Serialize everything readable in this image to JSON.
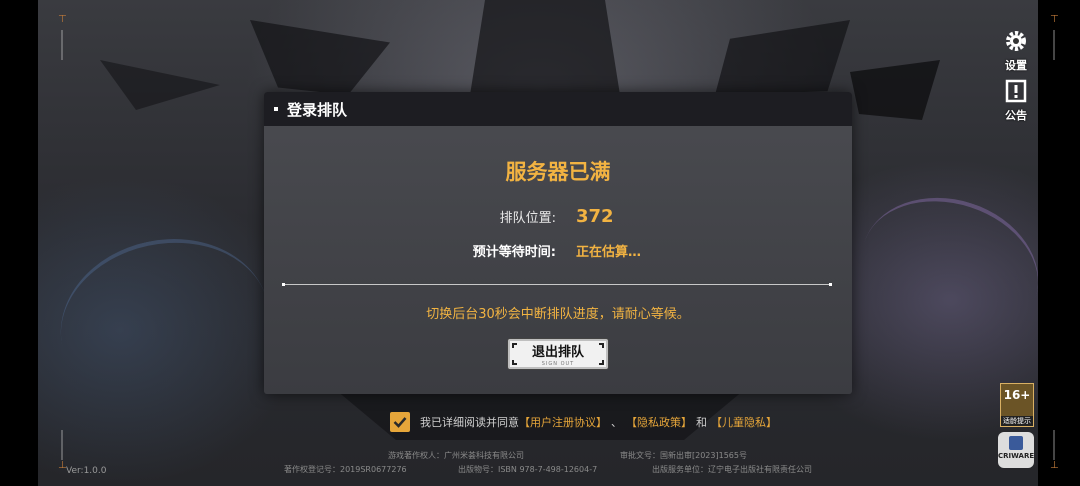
{
  "side": {
    "settings_label": "设置",
    "notice_label": "公告"
  },
  "dialog": {
    "title": "登录排队",
    "status": "服务器已满",
    "position_label": "排队位置:",
    "position_value": "372",
    "wait_label": "预计等待时间:",
    "wait_value": "正在估算…",
    "hint": "切换后台30秒会中断排队进度，请耐心等候。",
    "exit_label": "退出排队",
    "exit_sub": "SIGN OUT"
  },
  "agreement": {
    "prefix": "我已详细阅读并同意",
    "link1": "【用户注册协议】",
    "sep1": "、",
    "link2": "【隐私政策】",
    "sep2": "和",
    "link3": "【儿童隐私】"
  },
  "footer": {
    "copyright_owner": "游戏著作权人：广州米荟科技有限公司",
    "approval": "审批文号：国新出审[2023]1565号",
    "registration": "著作权登记号：2019SR0677276",
    "isbn": "出版物号：ISBN 978-7-498-12604-7",
    "publisher": "出版服务单位：辽宁电子出版社有限责任公司",
    "version": "Ver:1.0.0"
  },
  "rating": {
    "age": "16+",
    "sub": "适龄提示",
    "criware": "CRIWARE"
  },
  "colors": {
    "accent": "#f2b342",
    "dialog_header": "#1d1d22",
    "dialog_body": "#45464b"
  },
  "icons": {
    "settings": "gear-icon",
    "notice": "notice-icon",
    "checkbox": "check-icon"
  }
}
